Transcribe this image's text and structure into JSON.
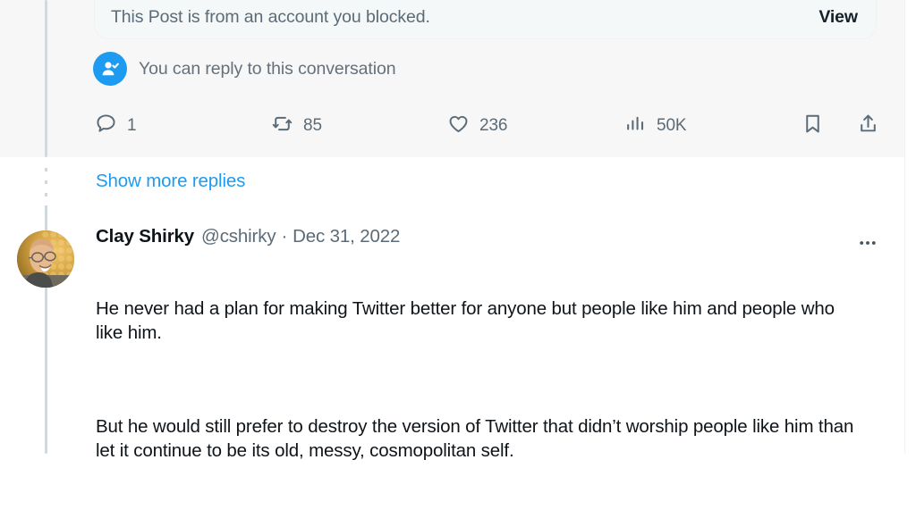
{
  "banner": {
    "message": "This Post is from an account you blocked.",
    "view_label": "View"
  },
  "reply_note": {
    "text": "You can reply to this conversation",
    "icon": "person-check-icon"
  },
  "actions": {
    "reply": {
      "icon": "reply-icon",
      "count": "1"
    },
    "repost": {
      "icon": "retweet-icon",
      "count": "85"
    },
    "like": {
      "icon": "heart-icon",
      "count": "236"
    },
    "views": {
      "icon": "analytics-icon",
      "count": "50K"
    },
    "bookmark": {
      "icon": "bookmark-icon"
    },
    "share": {
      "icon": "share-icon"
    }
  },
  "show_more": {
    "label": "Show more replies"
  },
  "tweet": {
    "author_name": "Clay Shirky",
    "handle": "@cshirky",
    "separator": "·",
    "date": "Dec 31, 2022",
    "avatar_alt": "clay-shirky-avatar",
    "more_icon": "more-options-icon",
    "paragraphs": [
      "He never had a plan for making Twitter better for anyone but people like him and people who like him.",
      "But he would still prefer to destroy the version of Twitter that didn’t worship people like him than let it continue to be its old, messy, cosmopolitan self."
    ]
  },
  "colors": {
    "accent_blue": "#1d9bf0",
    "text_primary": "#0f1419",
    "text_secondary": "#5b6b77",
    "thread_line": "#cfd9de",
    "hover_bg": "#f7f7f7",
    "banner_bg": "#f5f8f8"
  }
}
